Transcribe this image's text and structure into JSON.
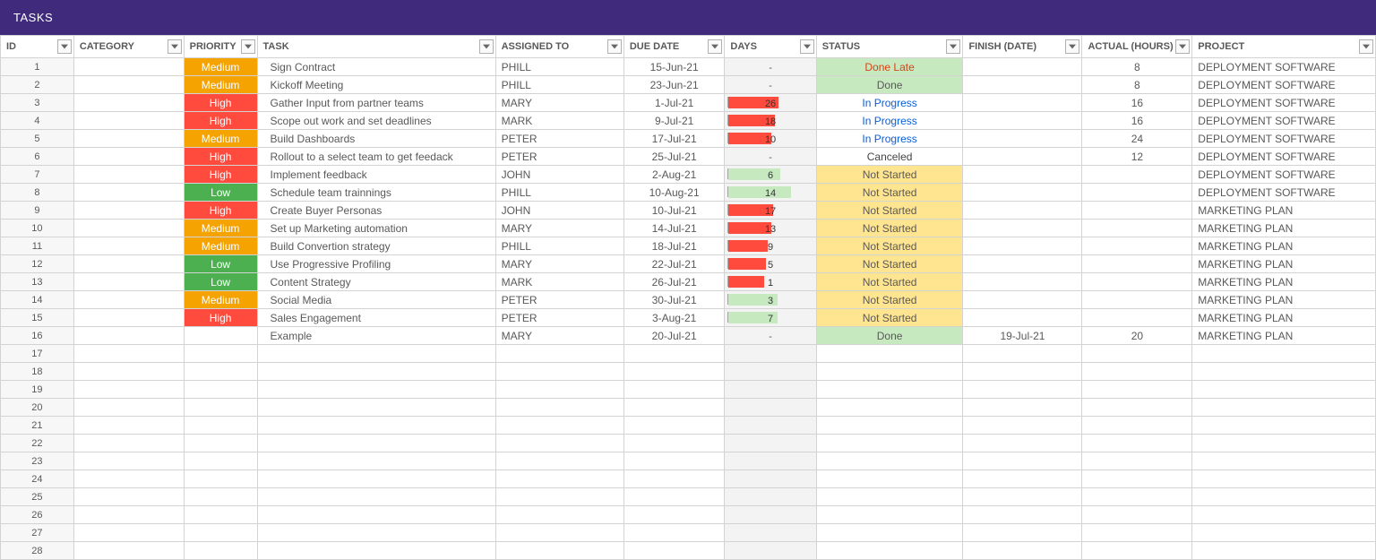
{
  "title": "TASKS",
  "columns": [
    "ID",
    "CATEGORY",
    "PRIORITY",
    "TASK",
    "ASSIGNED TO",
    "DUE DATE",
    "DAYS",
    "STATUS",
    "FINISH (DATE)",
    "ACTUAL (HOURS)",
    "PROJECT"
  ],
  "rows": [
    {
      "id": "1",
      "priority": "Medium",
      "task": "Sign Contract",
      "assigned": "PHILL",
      "due": "15-Jun-21",
      "days": "-",
      "status": "Done Late",
      "statusClass": "st-late",
      "finish": "",
      "actual": "8",
      "project": "DEPLOYMENT SOFTWARE",
      "bar": 0,
      "barGreen": false,
      "flag": ""
    },
    {
      "id": "2",
      "priority": "Medium",
      "task": "Kickoff Meeting",
      "assigned": "PHILL",
      "due": "23-Jun-21",
      "days": "-",
      "status": "Done",
      "statusClass": "st-done",
      "finish": "",
      "actual": "8",
      "project": "DEPLOYMENT SOFTWARE",
      "bar": 0,
      "barGreen": false,
      "flag": ""
    },
    {
      "id": "3",
      "priority": "High",
      "task": "Gather Input from partner teams",
      "assigned": "MARY",
      "due": "1-Jul-21",
      "days": "26",
      "status": "In Progress",
      "statusClass": "st-in",
      "finish": "",
      "actual": "16",
      "project": "DEPLOYMENT SOFTWARE",
      "bar": 56,
      "barGreen": false,
      "flag": "red"
    },
    {
      "id": "4",
      "priority": "High",
      "task": "Scope out work and set deadlines",
      "assigned": "MARK",
      "due": "9-Jul-21",
      "days": "18",
      "status": "In Progress",
      "statusClass": "st-in",
      "finish": "",
      "actual": "16",
      "project": "DEPLOYMENT SOFTWARE",
      "bar": 52,
      "barGreen": false,
      "flag": "red"
    },
    {
      "id": "5",
      "priority": "Medium",
      "task": "Build Dashboards",
      "assigned": "PETER",
      "due": "17-Jul-21",
      "days": "10",
      "status": "In Progress",
      "statusClass": "st-in",
      "finish": "",
      "actual": "24",
      "project": "DEPLOYMENT SOFTWARE",
      "bar": 48,
      "barGreen": false,
      "flag": "red"
    },
    {
      "id": "6",
      "priority": "High",
      "task": "Rollout to a select team to get feedack",
      "assigned": "PETER",
      "due": "25-Jul-21",
      "days": "-",
      "status": "Canceled",
      "statusClass": "st-cancel",
      "finish": "",
      "actual": "12",
      "project": "DEPLOYMENT SOFTWARE",
      "bar": 0,
      "barGreen": false,
      "flag": ""
    },
    {
      "id": "7",
      "priority": "High",
      "task": "Implement feedback",
      "assigned": "JOHN",
      "due": "2-Aug-21",
      "days": "6",
      "status": "Not Started",
      "statusClass": "st-not",
      "finish": "",
      "actual": "",
      "project": "DEPLOYMENT SOFTWARE",
      "bar": 58,
      "barGreen": true,
      "flag": "yellow"
    },
    {
      "id": "8",
      "priority": "Low",
      "task": "Schedule team trainnings",
      "assigned": "PHILL",
      "due": "10-Aug-21",
      "days": "14",
      "status": "Not Started",
      "statusClass": "st-not",
      "finish": "",
      "actual": "",
      "project": "DEPLOYMENT SOFTWARE",
      "bar": 70,
      "barGreen": true,
      "flag": "teal"
    },
    {
      "id": "9",
      "priority": "High",
      "task": "Create Buyer Personas",
      "assigned": "JOHN",
      "due": "10-Jul-21",
      "days": "17",
      "status": "Not Started",
      "statusClass": "st-not",
      "finish": "",
      "actual": "",
      "project": "MARKETING PLAN",
      "bar": 50,
      "barGreen": false,
      "flag": "red"
    },
    {
      "id": "10",
      "priority": "Medium",
      "task": "Set up Marketing automation",
      "assigned": "MARY",
      "due": "14-Jul-21",
      "days": "13",
      "status": "Not Started",
      "statusClass": "st-not",
      "finish": "",
      "actual": "",
      "project": "MARKETING PLAN",
      "bar": 48,
      "barGreen": false,
      "flag": "red"
    },
    {
      "id": "11",
      "priority": "Medium",
      "task": "Build Convertion strategy",
      "assigned": "PHILL",
      "due": "18-Jul-21",
      "days": "9",
      "status": "Not Started",
      "statusClass": "st-not",
      "finish": "",
      "actual": "",
      "project": "MARKETING PLAN",
      "bar": 44,
      "barGreen": false,
      "flag": "red"
    },
    {
      "id": "12",
      "priority": "Low",
      "task": "Use Progressive Profiling",
      "assigned": "MARY",
      "due": "22-Jul-21",
      "days": "5",
      "status": "Not Started",
      "statusClass": "st-not",
      "finish": "",
      "actual": "",
      "project": "MARKETING PLAN",
      "bar": 42,
      "barGreen": false,
      "flag": "red"
    },
    {
      "id": "13",
      "priority": "Low",
      "task": "Content Strategy",
      "assigned": "MARK",
      "due": "26-Jul-21",
      "days": "1",
      "status": "Not Started",
      "statusClass": "st-not",
      "finish": "",
      "actual": "",
      "project": "MARKETING PLAN",
      "bar": 40,
      "barGreen": false,
      "flag": "red"
    },
    {
      "id": "14",
      "priority": "Medium",
      "task": "Social Media",
      "assigned": "PETER",
      "due": "30-Jul-21",
      "days": "3",
      "status": "Not Started",
      "statusClass": "st-not",
      "finish": "",
      "actual": "",
      "project": "MARKETING PLAN",
      "bar": 55,
      "barGreen": true,
      "flag": "yellow"
    },
    {
      "id": "15",
      "priority": "High",
      "task": "Sales Engagement",
      "assigned": "PETER",
      "due": "3-Aug-21",
      "days": "7",
      "status": "Not Started",
      "statusClass": "st-not",
      "finish": "",
      "actual": "",
      "project": "MARKETING PLAN",
      "bar": 55,
      "barGreen": true,
      "flag": "yellow"
    },
    {
      "id": "16",
      "priority": "",
      "task": "Example",
      "assigned": "MARY",
      "due": "20-Jul-21",
      "days": "-",
      "status": "Done",
      "statusClass": "st-done",
      "finish": "19-Jul-21",
      "actual": "20",
      "project": "MARKETING PLAN",
      "bar": 0,
      "barGreen": false,
      "flag": ""
    }
  ],
  "emptyRows": [
    "17",
    "18",
    "19",
    "20",
    "21",
    "22",
    "23",
    "24",
    "25",
    "26",
    "27",
    "28"
  ]
}
